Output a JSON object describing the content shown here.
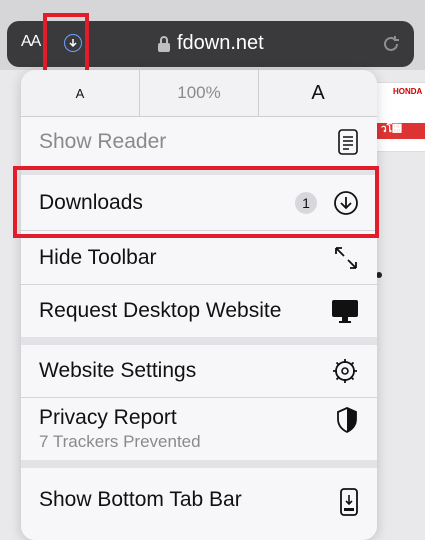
{
  "address_bar": {
    "text_size_label": "AA",
    "url": "fdown.net"
  },
  "zoom": {
    "decrease_label": "A",
    "level": "100%",
    "increase_label": "A"
  },
  "menu": {
    "show_reader": "Show Reader",
    "downloads": "Downloads",
    "downloads_count": "1",
    "hide_toolbar": "Hide Toolbar",
    "request_desktop": "Request Desktop Website",
    "website_settings": "Website Settings",
    "privacy_report": "Privacy Report",
    "privacy_subtitle": "7 Trackers Prevented",
    "show_bottom_tab_bar": "Show Bottom Tab Bar"
  },
  "background": {
    "ad_brand": "HONDA",
    "ad_text": "วโ๭"
  },
  "colors": {
    "highlight": "#e11d2b",
    "address_bar": "#3a3a3c",
    "download_indicator": "#6aa0ff"
  }
}
